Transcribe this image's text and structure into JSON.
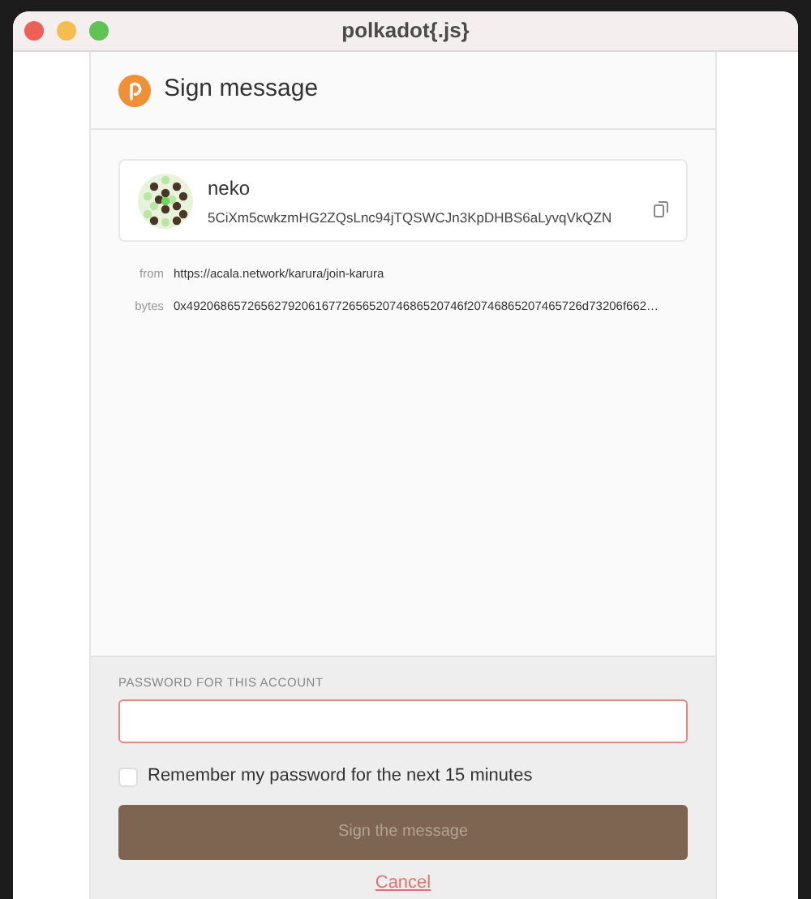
{
  "window": {
    "title": "polkadot{.js}"
  },
  "header": {
    "title": "Sign message"
  },
  "account": {
    "name": "neko",
    "address": "5CiXm5cwkzmHG2ZQsLnc94jTQSWCJn3KpDHBS6aLyvqVkQZN"
  },
  "details": [
    {
      "label": "from",
      "value": "https://acala.network/karura/join-karura"
    },
    {
      "label": "bytes",
      "value": "0x49206865726562792061677265652074686520746f20746865207465726d73206f662…"
    }
  ],
  "password": {
    "label": "PASSWORD FOR THIS ACCOUNT",
    "invalid": true
  },
  "remember": {
    "label": "Remember my password for the next 15 minutes",
    "checked": false
  },
  "sign_button": {
    "label": "Sign the message",
    "disabled": true
  },
  "cancel": {
    "label": "Cancel"
  }
}
